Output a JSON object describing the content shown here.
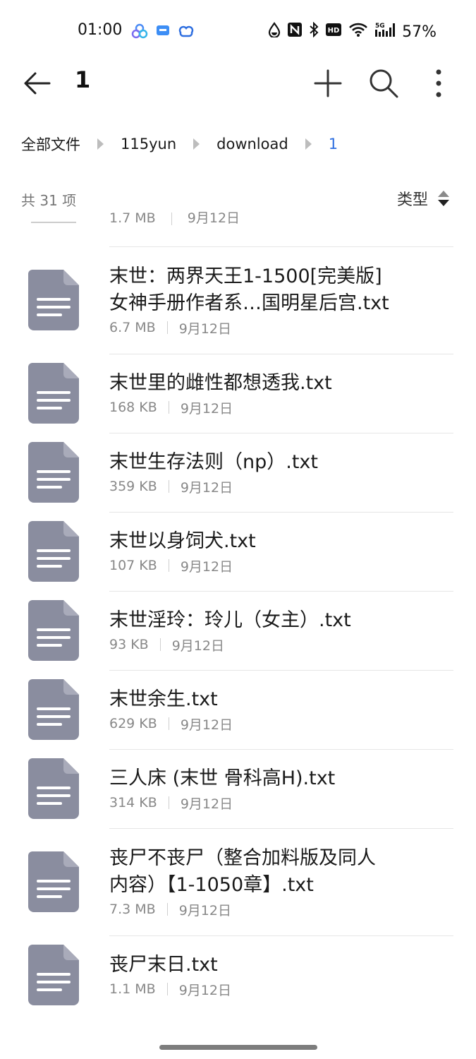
{
  "status_bar": {
    "time": "01:00",
    "battery": "57%",
    "network": "5G"
  },
  "topbar": {
    "title": "1"
  },
  "breadcrumb": [
    "全部文件",
    "115yun",
    "download",
    "1"
  ],
  "summary": {
    "count": "共 31 项",
    "sort_label": "类型"
  },
  "partial_row": {
    "size": "1.7 MB",
    "date": "9月12日"
  },
  "files": [
    {
      "name": "末世：两界天王1-1500[完美版]\n女神手册作者系…国明星后宫.txt",
      "size": "6.7 MB",
      "date": "9月12日"
    },
    {
      "name": "末世里的雌性都想透我.txt",
      "size": "168 KB",
      "date": "9月12日"
    },
    {
      "name": "末世生存法则（np）.txt",
      "size": "359 KB",
      "date": "9月12日"
    },
    {
      "name": "末世以身饲犬.txt",
      "size": "107 KB",
      "date": "9月12日"
    },
    {
      "name": "末世淫玲：玲儿（女主）.txt",
      "size": "93 KB",
      "date": "9月12日"
    },
    {
      "name": "末世余生.txt",
      "size": "629 KB",
      "date": "9月12日"
    },
    {
      "name": "三人床 (末世 骨科高H).txt",
      "size": "314 KB",
      "date": "9月12日"
    },
    {
      "name": "丧尸不丧尸（整合加料版及同人\n内容）【1-1050章】.txt",
      "size": "7.3 MB",
      "date": "9月12日"
    },
    {
      "name": "丧尸末日.txt",
      "size": "1.1 MB",
      "date": "9月12日"
    }
  ],
  "icons": {
    "back": "back-arrow-icon",
    "add": "plus-icon",
    "search": "search-icon",
    "more": "more-vertical-icon",
    "file": "document-icon"
  },
  "colors": {
    "accent": "#2f6fe0",
    "file_icon": "#8a8d9f"
  }
}
